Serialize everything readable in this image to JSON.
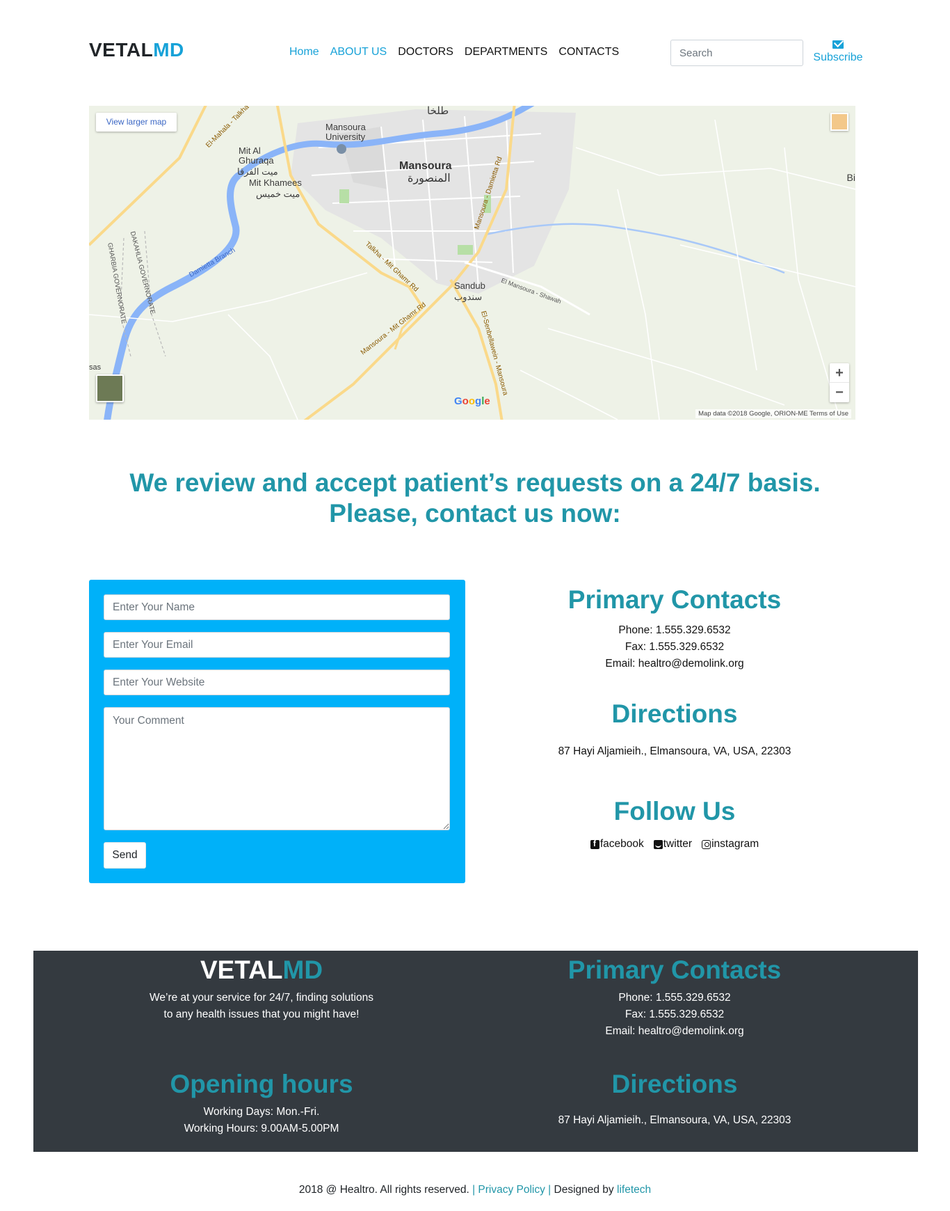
{
  "header": {
    "logo_part1": "VETAL",
    "logo_part2": "MD",
    "nav": [
      {
        "label": "Home",
        "active": true
      },
      {
        "label": "ABOUT US",
        "active": true
      },
      {
        "label": "DOCTORS",
        "active": false
      },
      {
        "label": "DEPARTMENTS",
        "active": false
      },
      {
        "label": "CONTACTS",
        "active": false
      }
    ],
    "search_placeholder": "Search",
    "subscribe_label": "Subscribe",
    "subscribe_icon": "envelope-icon"
  },
  "map": {
    "larger_map_label": "View larger map",
    "zoom_in": "+",
    "zoom_out": "−",
    "google": [
      "G",
      "o",
      "o",
      "g",
      "l",
      "e"
    ],
    "credit": "Map data ©2018 Google, ORION-ME    Terms of Use",
    "labels": {
      "city": "Mansoura",
      "city_ar": "المنصورة",
      "university": "Mansoura\nUniversity",
      "mit_al_ghuraqa": "Mit Al\nGhuraqa",
      "mit_al_ghuraqa_ar": "ميت الفرقا",
      "mit_khamees": "Mit Khamees",
      "mit_khamees_ar": "ميت خميس",
      "sandub": "Sandub",
      "sandub_ar": "سندوب",
      "talkha_ar": "طلخا",
      "road_talkha_mit_ghamr": "Talkha - Mit Ghamr Rd",
      "road_mansoura_mit_ghamr": "Mansoura - Mit Ghamr Rd",
      "road_mansoura_damietta": "Mansoura - Damietta Rd",
      "road_senbellawein": "El-Senbellawein - Mansoura",
      "gharbia": "GHARBIA GOVERNORATE",
      "dakahlia": "DAKAHLIA GOVERNORATE",
      "damietta_branch": "Damietta Branch",
      "el_mahala": "El-Mahala - Talkha",
      "shawah": "El Mansoura - Shawah",
      "edge_left": "sas",
      "edge_right": "Bi"
    }
  },
  "tagline": {
    "line1": "We review and accept patient’s requests on a 24/7 basis.",
    "line2": "Please, contact us now:"
  },
  "form": {
    "name_placeholder": "Enter Your Name",
    "email_placeholder": "Enter Your Email",
    "website_placeholder": "Enter Your Website",
    "comment_placeholder": "Your Comment",
    "send_label": "Send",
    "bg_color": "#00b1f9"
  },
  "contacts": {
    "primary_title": "Primary Contacts",
    "phone": "Phone: 1.555.329.6532",
    "fax": "Fax: 1.555.329.6532",
    "email": "Email: healtro@demolink.org",
    "directions_title": "Directions",
    "address": "87 Hayi Aljamieih., Elmansoura, VA, USA, 22303",
    "follow_title": "Follow Us",
    "social": [
      {
        "label": "facebook",
        "icon": "facebook-icon"
      },
      {
        "label": "twitter",
        "icon": "twitter-icon"
      },
      {
        "label": "instagram",
        "icon": "instagram-icon"
      }
    ]
  },
  "footer": {
    "logo_part1": "VETAL",
    "logo_part2": "MD",
    "about_line1": "We’re at your service for 24/7, finding solutions",
    "about_line2": "to any health issues that you might have!",
    "primary_title": "Primary Contacts",
    "phone": "Phone: 1.555.329.6532",
    "fax": "Fax: 1.555.329.6532",
    "email": "Email: healtro@demolink.org",
    "hours_title": "Opening hours",
    "working_days": "Working Days: Mon.-Fri.",
    "working_hours": "Working Hours: 9.00AM-5.00PM",
    "directions_title": "Directions",
    "address": "87 Hayi Aljamieih., Elmansoura, VA, USA, 22303",
    "bg_color": "#343a40"
  },
  "copyright": {
    "text": "2018 @ Healtro. All rights reserved.",
    "sep1": " | ",
    "privacy": "Privacy Policy",
    "sep2": " | ",
    "designed_by": "Designed by ",
    "designer": "lifetech"
  },
  "colors": {
    "accent": "#17a2d8",
    "heading": "#2196a8"
  }
}
